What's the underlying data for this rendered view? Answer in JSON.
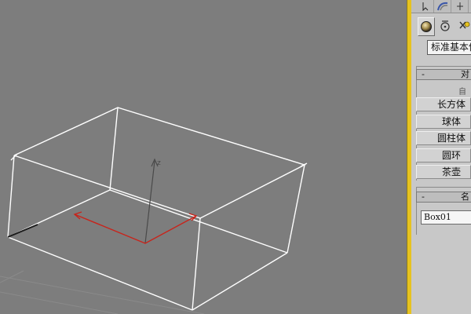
{
  "command_panel": {
    "tabs": [
      {
        "name": "create-tab",
        "icon": "arrow-cursor-icon"
      },
      {
        "name": "modify-tab",
        "icon": "modify-arc-icon"
      },
      {
        "name": "hierarchy-tab",
        "icon": "hierarchy-icon"
      }
    ],
    "subtypes": [
      {
        "name": "geometry-button",
        "icon": "sphere-icon",
        "active": true
      },
      {
        "name": "shapes-button",
        "icon": "shapes-icon",
        "active": false
      },
      {
        "name": "lights-button",
        "icon": "light-icon",
        "active": false
      }
    ],
    "category_dropdown": "标准基本体",
    "object_type_rollout": {
      "toggle": "-",
      "title": "对",
      "autogrid_label": "自",
      "buttons": [
        "长方体",
        "球体",
        "圆柱体",
        "圆环",
        "茶壶"
      ]
    },
    "name_rollout": {
      "toggle": "-",
      "title": "名",
      "object_name": "Box01"
    }
  },
  "viewport": {
    "axis_x_color": "#c8241b",
    "axis_z_color": "#4a4a4a",
    "wire_color": "#ffffff",
    "z_axis_label": "z"
  }
}
